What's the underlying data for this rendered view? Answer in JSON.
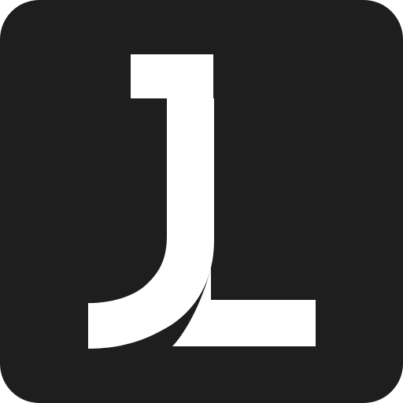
{
  "icon": {
    "name": "jl-logo-icon",
    "lettering": "JL",
    "background_color": "#1e1e1e",
    "glyph_color": "#ffffff"
  }
}
